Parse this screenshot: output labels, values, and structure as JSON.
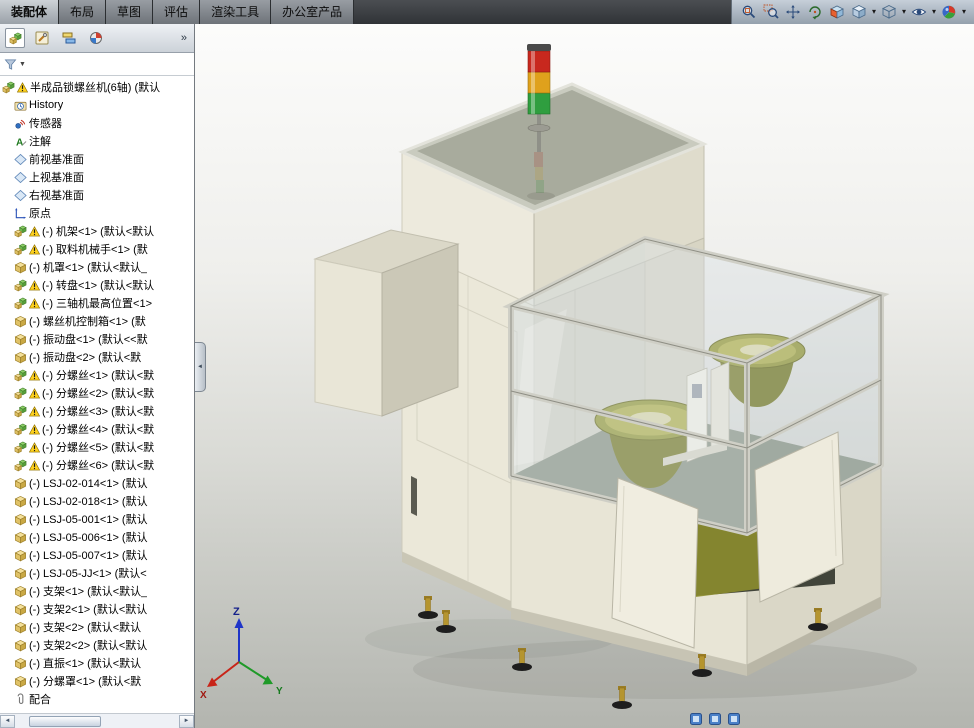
{
  "command_bar": {
    "active_tab": "装配体",
    "tabs": [
      "装配体",
      "布局",
      "草图",
      "评估",
      "渲染工具",
      "办公室产品"
    ]
  },
  "view_toolbar": {
    "icons": [
      "zoom-fit-icon",
      "zoom-area-icon",
      "pan-icon",
      "rotate-view-icon",
      "section-view-icon",
      "view-orientation-icon",
      "display-style-icon",
      "hide-show-icon",
      "edit-appearance-icon"
    ],
    "with_caret": [
      "view-orientation-icon",
      "display-style-icon",
      "hide-show-icon",
      "edit-appearance-icon"
    ]
  },
  "sidebar": {
    "tabs": [
      "featuremanager-tab-icon",
      "propertymanager-tab-icon",
      "configurationmanager-tab-icon",
      "displaymanager-tab-icon"
    ],
    "overflow_chevron": "»",
    "filter": {
      "icon": "filter-icon",
      "caret": "▼"
    },
    "hscroll": {
      "left": "◄",
      "right": "►"
    }
  },
  "feature_tree": {
    "items": [
      {
        "icon": "assembly-icon",
        "warn": true,
        "indent": 0,
        "label": "半成品锁螺丝机(6轴) (默认"
      },
      {
        "icon": "history-icon",
        "warn": false,
        "indent": 1,
        "label": "History"
      },
      {
        "icon": "sensors-icon",
        "warn": false,
        "indent": 1,
        "label": "传感器"
      },
      {
        "icon": "annotations-icon",
        "warn": false,
        "indent": 1,
        "label": "注解"
      },
      {
        "icon": "plane-icon",
        "warn": false,
        "indent": 1,
        "label": "前视基准面"
      },
      {
        "icon": "plane-icon",
        "warn": false,
        "indent": 1,
        "label": "上视基准面"
      },
      {
        "icon": "plane-icon",
        "warn": false,
        "indent": 1,
        "label": "右视基准面"
      },
      {
        "icon": "origin-icon",
        "warn": false,
        "indent": 1,
        "label": "原点"
      },
      {
        "icon": "assembly-icon",
        "warn": true,
        "indent": 1,
        "label": "(-) 机架<1> (默认<默认"
      },
      {
        "icon": "assembly-icon",
        "warn": true,
        "indent": 1,
        "label": "(-) 取料机械手<1> (默"
      },
      {
        "icon": "part-icon",
        "warn": false,
        "indent": 1,
        "label": "(-) 机罩<1> (默认<默认_"
      },
      {
        "icon": "assembly-icon",
        "warn": true,
        "indent": 1,
        "label": "(-) 转盘<1> (默认<默认"
      },
      {
        "icon": "assembly-icon",
        "warn": true,
        "indent": 1,
        "label": "(-) 三轴机最高位置<1>"
      },
      {
        "icon": "part-icon",
        "warn": false,
        "indent": 1,
        "label": "(-) 螺丝机控制箱<1> (默"
      },
      {
        "icon": "part-icon",
        "warn": false,
        "indent": 1,
        "label": "(-) 振动盘<1> (默认<<默"
      },
      {
        "icon": "part-icon",
        "warn": false,
        "indent": 1,
        "label": "(-) 振动盘<2> (默认<默"
      },
      {
        "icon": "assembly-icon",
        "warn": true,
        "indent": 1,
        "label": "(-) 分螺丝<1> (默认<默"
      },
      {
        "icon": "assembly-icon",
        "warn": true,
        "indent": 1,
        "label": "(-) 分螺丝<2> (默认<默"
      },
      {
        "icon": "assembly-icon",
        "warn": true,
        "indent": 1,
        "label": "(-) 分螺丝<3> (默认<默"
      },
      {
        "icon": "assembly-icon",
        "warn": true,
        "indent": 1,
        "label": "(-) 分螺丝<4> (默认<默"
      },
      {
        "icon": "assembly-icon",
        "warn": true,
        "indent": 1,
        "label": "(-) 分螺丝<5> (默认<默"
      },
      {
        "icon": "assembly-icon",
        "warn": true,
        "indent": 1,
        "label": "(-) 分螺丝<6> (默认<默"
      },
      {
        "icon": "part-icon",
        "warn": false,
        "indent": 1,
        "label": "(-) LSJ-02-014<1> (默认"
      },
      {
        "icon": "part-icon",
        "warn": false,
        "indent": 1,
        "label": "(-) LSJ-02-018<1> (默认"
      },
      {
        "icon": "part-icon",
        "warn": false,
        "indent": 1,
        "label": "(-) LSJ-05-001<1> (默认"
      },
      {
        "icon": "part-icon",
        "warn": false,
        "indent": 1,
        "label": "(-) LSJ-05-006<1> (默认"
      },
      {
        "icon": "part-icon",
        "warn": false,
        "indent": 1,
        "label": "(-) LSJ-05-007<1> (默认"
      },
      {
        "icon": "part-icon",
        "warn": false,
        "indent": 1,
        "label": "(-) LSJ-05-JJ<1> (默认<"
      },
      {
        "icon": "part-icon",
        "warn": false,
        "indent": 1,
        "label": "(-) 支架<1> (默认<默认_"
      },
      {
        "icon": "part-icon",
        "warn": false,
        "indent": 1,
        "label": "(-) 支架2<1> (默认<默认"
      },
      {
        "icon": "part-icon",
        "warn": false,
        "indent": 1,
        "label": "(-) 支架<2> (默认<默认"
      },
      {
        "icon": "part-icon",
        "warn": false,
        "indent": 1,
        "label": "(-) 支架2<2> (默认<默认"
      },
      {
        "icon": "part-icon",
        "warn": false,
        "indent": 1,
        "label": "(-) 直振<1> (默认<默认"
      },
      {
        "icon": "part-icon",
        "warn": false,
        "indent": 1,
        "label": "(-) 分螺罩<1> (默认<默"
      },
      {
        "icon": "mates-icon",
        "warn": false,
        "indent": 1,
        "label": "配合"
      }
    ]
  },
  "viewport": {
    "splitter_glyph": "◄",
    "triad": {
      "x_label": "X",
      "y_label": "Y",
      "z_label": "Z"
    },
    "bottom_icons": [
      "document-icon",
      "document-icon",
      "document-icon"
    ],
    "colors": {
      "machine_panel_beige": "#e9e6d7",
      "bowl_olive": "#999c41",
      "tower_red": "#c8281e",
      "tower_yellow": "#dfa11c",
      "tower_green": "#2f9e3f",
      "viewport_top": "#fcfcfb",
      "viewport_bottom": "#b3b5af"
    }
  }
}
